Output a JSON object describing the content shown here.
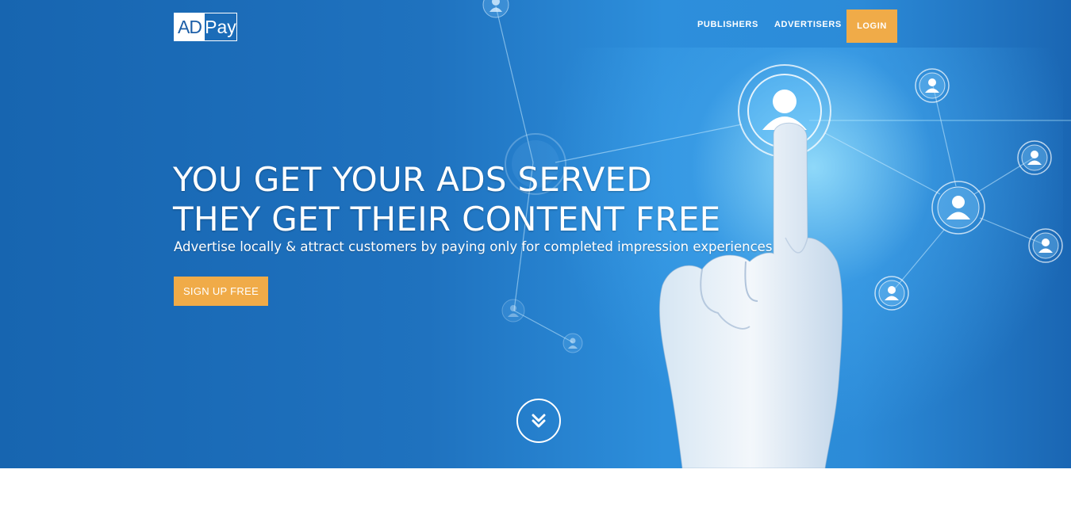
{
  "brand": {
    "logo_left": "AD",
    "logo_right": "Pay"
  },
  "nav": {
    "publishers": "PUBLISHERS",
    "advertisers": "ADVERTISERS",
    "login": "LOGIN"
  },
  "hero": {
    "headline_line1": "YOU GET YOUR ADS SERVED",
    "headline_line2": "THEY GET THEIR CONTENT FREE",
    "subheadline": "Advertise locally & attract customers by paying only for completed impression experiences",
    "cta_label": "SIGN UP FREE"
  },
  "icons": {
    "scroll": "double-chevron-down-icon",
    "network_node": "user-icon"
  },
  "colors": {
    "accent": "#f0ab48",
    "hero_blue": "#1f72bf",
    "text": "#ffffff"
  }
}
